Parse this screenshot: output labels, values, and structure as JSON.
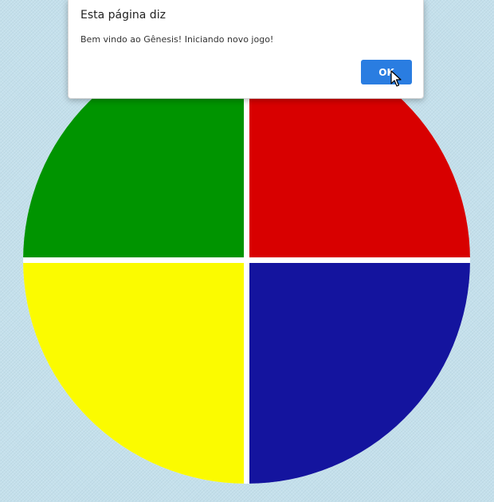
{
  "board": {
    "quadrants": [
      {
        "id": "green",
        "color": "#009400"
      },
      {
        "id": "red",
        "color": "#d80000"
      },
      {
        "id": "yellow",
        "color": "#fbfb00"
      },
      {
        "id": "blue",
        "color": "#14149e"
      }
    ],
    "background_color": "#c4e0ec"
  },
  "dialog": {
    "title": "Esta página diz",
    "message": "Bem vindo ao Gênesis! Iniciando novo jogo!",
    "ok_label": "OK",
    "ok_color": "#2a7de1"
  },
  "cursor": {
    "icon": "mouse-pointer-icon"
  }
}
